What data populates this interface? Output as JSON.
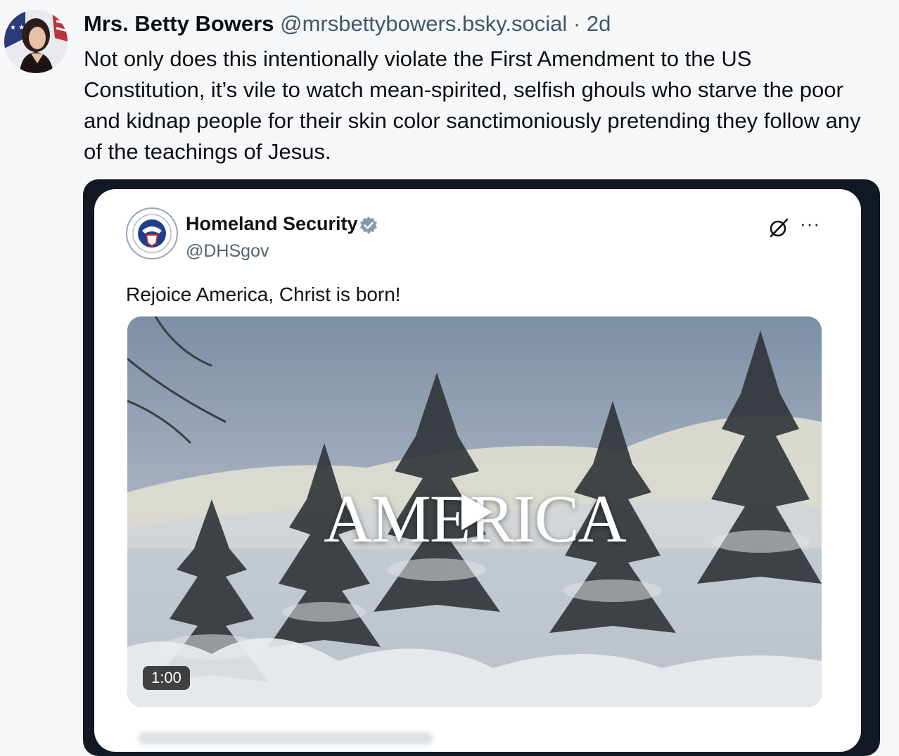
{
  "post": {
    "display_name": "Mrs. Betty Bowers",
    "handle": "@mrsbettybowers.bsky.social",
    "separator": "·",
    "age": "2d",
    "text": "Not only does this intentionally violate the First Amendment to the US Constitution, it’s vile to watch mean-spirited, selfish ghouls who starve the poor and kidnap people for their skin color sanctimoniously pretending they follow any of the teachings of Jesus."
  },
  "embed": {
    "account_name": "Homeland Security",
    "account_handle": "@DHSgov",
    "more_label": "···",
    "text": "Rejoice America, Christ is born!",
    "video": {
      "title_overlay": "AMERICA",
      "duration": "1:00"
    },
    "icons": {
      "verified": "verified-badge-icon",
      "grok": "grok-icon",
      "more": "more-icon",
      "play": "play-icon"
    }
  },
  "colors": {
    "background": "#f6f7f9",
    "frame": "#121824",
    "secondary_text": "#42576c",
    "verified": "#829aab"
  }
}
